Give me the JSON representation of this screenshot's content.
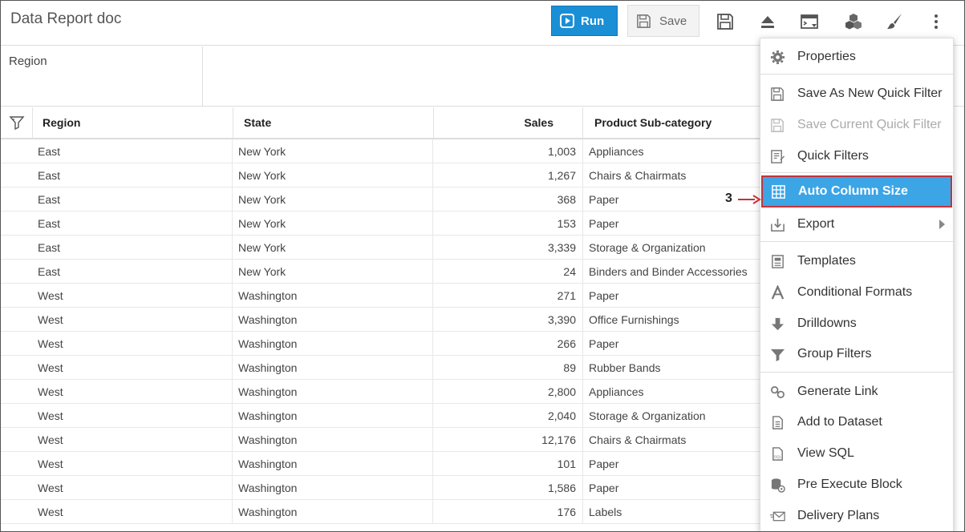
{
  "header": {
    "title": "Data Report doc",
    "run_label": "Run",
    "save_label": "Save"
  },
  "toolbar_icons": [
    "save-icon",
    "eject-icon",
    "console-icon",
    "cubes-icon",
    "paint-brush-icon",
    "more-vert-icon"
  ],
  "region_filter": {
    "label": "Region"
  },
  "table": {
    "columns": [
      "Region",
      "State",
      "Sales",
      "Product Sub-category"
    ],
    "rows": [
      [
        "East",
        "New York",
        "1,003",
        "Appliances"
      ],
      [
        "East",
        "New York",
        "1,267",
        "Chairs & Chairmats"
      ],
      [
        "East",
        "New York",
        "368",
        "Paper"
      ],
      [
        "East",
        "New York",
        "153",
        "Paper"
      ],
      [
        "East",
        "New York",
        "3,339",
        "Storage & Organization"
      ],
      [
        "East",
        "New York",
        "24",
        "Binders and Binder Accessories"
      ],
      [
        "West",
        "Washington",
        "271",
        "Paper"
      ],
      [
        "West",
        "Washington",
        "3,390",
        "Office Furnishings"
      ],
      [
        "West",
        "Washington",
        "266",
        "Paper"
      ],
      [
        "West",
        "Washington",
        "89",
        "Rubber Bands"
      ],
      [
        "West",
        "Washington",
        "2,800",
        "Appliances"
      ],
      [
        "West",
        "Washington",
        "2,040",
        "Storage & Organization"
      ],
      [
        "West",
        "Washington",
        "12,176",
        "Chairs & Chairmats"
      ],
      [
        "West",
        "Washington",
        "101",
        "Paper"
      ],
      [
        "West",
        "Washington",
        "1,586",
        "Paper"
      ],
      [
        "West",
        "Washington",
        "176",
        "Labels"
      ]
    ]
  },
  "menu": {
    "items": [
      {
        "label": "Properties",
        "icon": "gear-icon"
      },
      {
        "label": "Save As New Quick Filter",
        "icon": "save-as-icon"
      },
      {
        "label": "Save Current Quick Filter",
        "icon": "save-current-icon",
        "disabled": true
      },
      {
        "label": "Quick Filters",
        "icon": "quick-filters-icon"
      },
      {
        "label": "Auto Column Size",
        "icon": "grid-icon",
        "active": true
      },
      {
        "label": "Export",
        "icon": "export-icon",
        "submenu": true
      },
      {
        "label": "Templates",
        "icon": "templates-icon"
      },
      {
        "label": "Conditional Formats",
        "icon": "font-a-icon"
      },
      {
        "label": "Drilldowns",
        "icon": "arrow-down-icon"
      },
      {
        "label": "Group Filters",
        "icon": "group-filter-icon"
      },
      {
        "label": "Generate Link",
        "icon": "link-icon"
      },
      {
        "label": "Add to Dataset",
        "icon": "document-icon"
      },
      {
        "label": "View SQL",
        "icon": "sql-file-icon"
      },
      {
        "label": "Pre Execute Block",
        "icon": "database-gear-icon"
      },
      {
        "label": "Delivery Plans",
        "icon": "envelope-icon"
      }
    ]
  },
  "annotation": {
    "step": "3"
  },
  "colors": {
    "run_blue": "#1a8fd6",
    "menu_active": "#3ba5e6",
    "highlight_border": "#c3343a"
  }
}
